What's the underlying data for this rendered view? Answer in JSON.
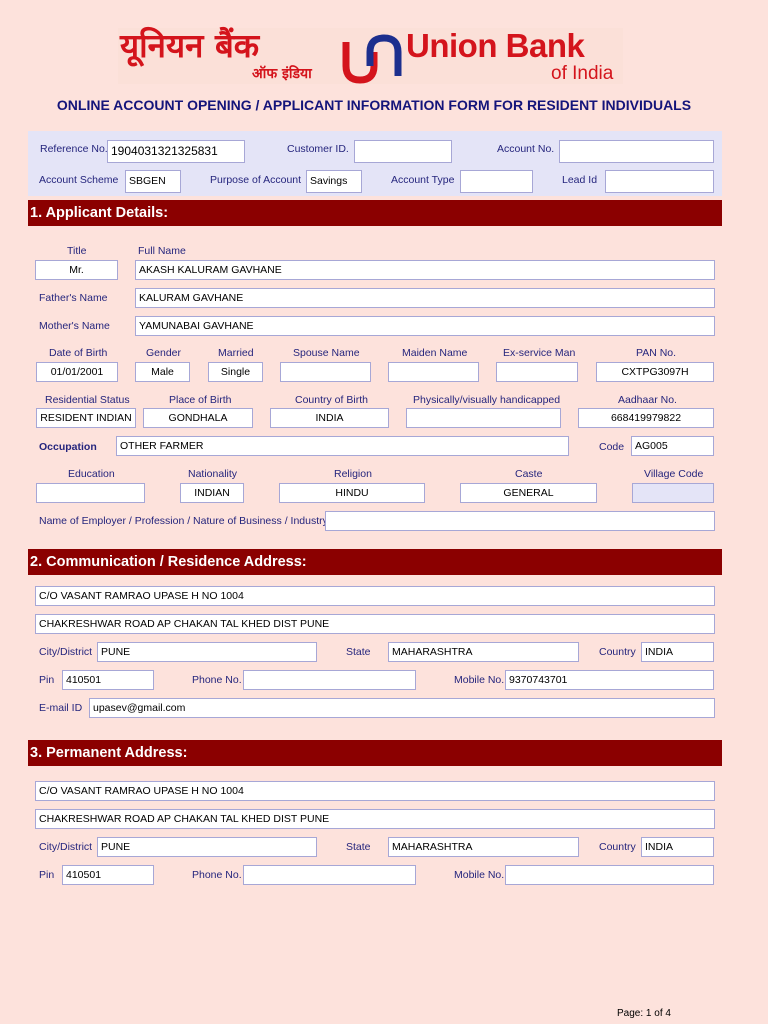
{
  "logo": {
    "hindi": "यूनियन बैंक",
    "hindi_sub": "ऑफ इंडिया",
    "english": "Union Bank",
    "english_sub": "of India"
  },
  "form_title": "ONLINE ACCOUNT OPENING / APPLICANT INFORMATION FORM FOR RESIDENT INDIVIDUALS",
  "top": {
    "reference_no_label": "Reference No.",
    "reference_no": "1904031321325831",
    "customer_id_label": "Customer ID.",
    "customer_id": "",
    "account_no_label": "Account No.",
    "account_no": "",
    "account_scheme_label": "Account Scheme",
    "account_scheme": "SBGEN",
    "purpose_label": "Purpose of Account",
    "purpose": "Savings",
    "account_type_label": "Account Type",
    "account_type": "",
    "lead_id_label": "Lead Id",
    "lead_id": ""
  },
  "applicant": {
    "heading": "1. Applicant Details:",
    "title_label": "Title",
    "title": "Mr.",
    "full_name_label": "Full Name",
    "full_name": "AKASH KALURAM GAVHANE",
    "father_label": "Father's Name",
    "father": "KALURAM GAVHANE",
    "mother_label": "Mother's Name",
    "mother": "YAMUNABAI GAVHANE",
    "dob_label": "Date of Birth",
    "dob": "01/01/2001",
    "gender_label": "Gender",
    "gender": "Male",
    "married_label": "Married",
    "married": "Single",
    "spouse_label": "Spouse Name",
    "spouse": "",
    "maiden_label": "Maiden Name",
    "maiden": "",
    "exservice_label": "Ex-service Man",
    "exservice": "",
    "pan_label": "PAN No.",
    "pan": "CXTPG3097H",
    "residential_label": "Residential Status",
    "residential": "RESIDENT INDIAN",
    "birthplace_label": "Place of Birth",
    "birthplace": "GONDHALA",
    "birthcountry_label": "Country of Birth",
    "birthcountry": "INDIA",
    "handicapped_label": "Physically/visually handicapped",
    "handicapped": "",
    "aadhaar_label": "Aadhaar No.",
    "aadhaar": "668419979822",
    "occupation_label": "Occupation",
    "occupation": "OTHER FARMER",
    "code_label": "Code",
    "code": "AG005",
    "education_label": "Education",
    "education": "",
    "nationality_label": "Nationality",
    "nationality": "INDIAN",
    "religion_label": "Religion",
    "religion": "HINDU",
    "caste_label": "Caste",
    "caste": "GENERAL",
    "village_label": "Village Code",
    "village": "",
    "employer_label": "Name of Employer / Profession / Nature of Business / Industry",
    "employer": ""
  },
  "communication": {
    "heading": "2. Communication / Residence Address:",
    "line1": "C/O VASANT RAMRAO UPASE H NO 1004",
    "line2": "CHAKRESHWAR ROAD AP CHAKAN TAL KHED DIST PUNE",
    "city_label": "City/District",
    "city": "PUNE",
    "state_label": "State",
    "state": "MAHARASHTRA",
    "country_label": "Country",
    "country": "INDIA",
    "pin_label": "Pin",
    "pin": "410501",
    "phone_label": "Phone No.",
    "phone": "",
    "mobile_label": "Mobile No.",
    "mobile": "9370743701",
    "email_label": "E-mail ID",
    "email": "upasev@gmail.com"
  },
  "permanent": {
    "heading": "3. Permanent Address:",
    "line1": "C/O VASANT RAMRAO UPASE H NO 1004",
    "line2": "CHAKRESHWAR ROAD AP CHAKAN TAL KHED DIST PUNE",
    "city_label": "City/District",
    "city": "PUNE",
    "state_label": "State",
    "state": "MAHARASHTRA",
    "country_label": "Country",
    "country": "INDIA",
    "pin_label": "Pin",
    "pin": "410501",
    "phone_label": "Phone No.",
    "phone": "",
    "mobile_label": "Mobile No.",
    "mobile": ""
  },
  "page_num": "Page: 1 of 4",
  "colors": {
    "brand_red": "#d4141c",
    "section_band": "#8b0000",
    "label_blue": "#25257d",
    "page_bg": "#fde2dc"
  }
}
